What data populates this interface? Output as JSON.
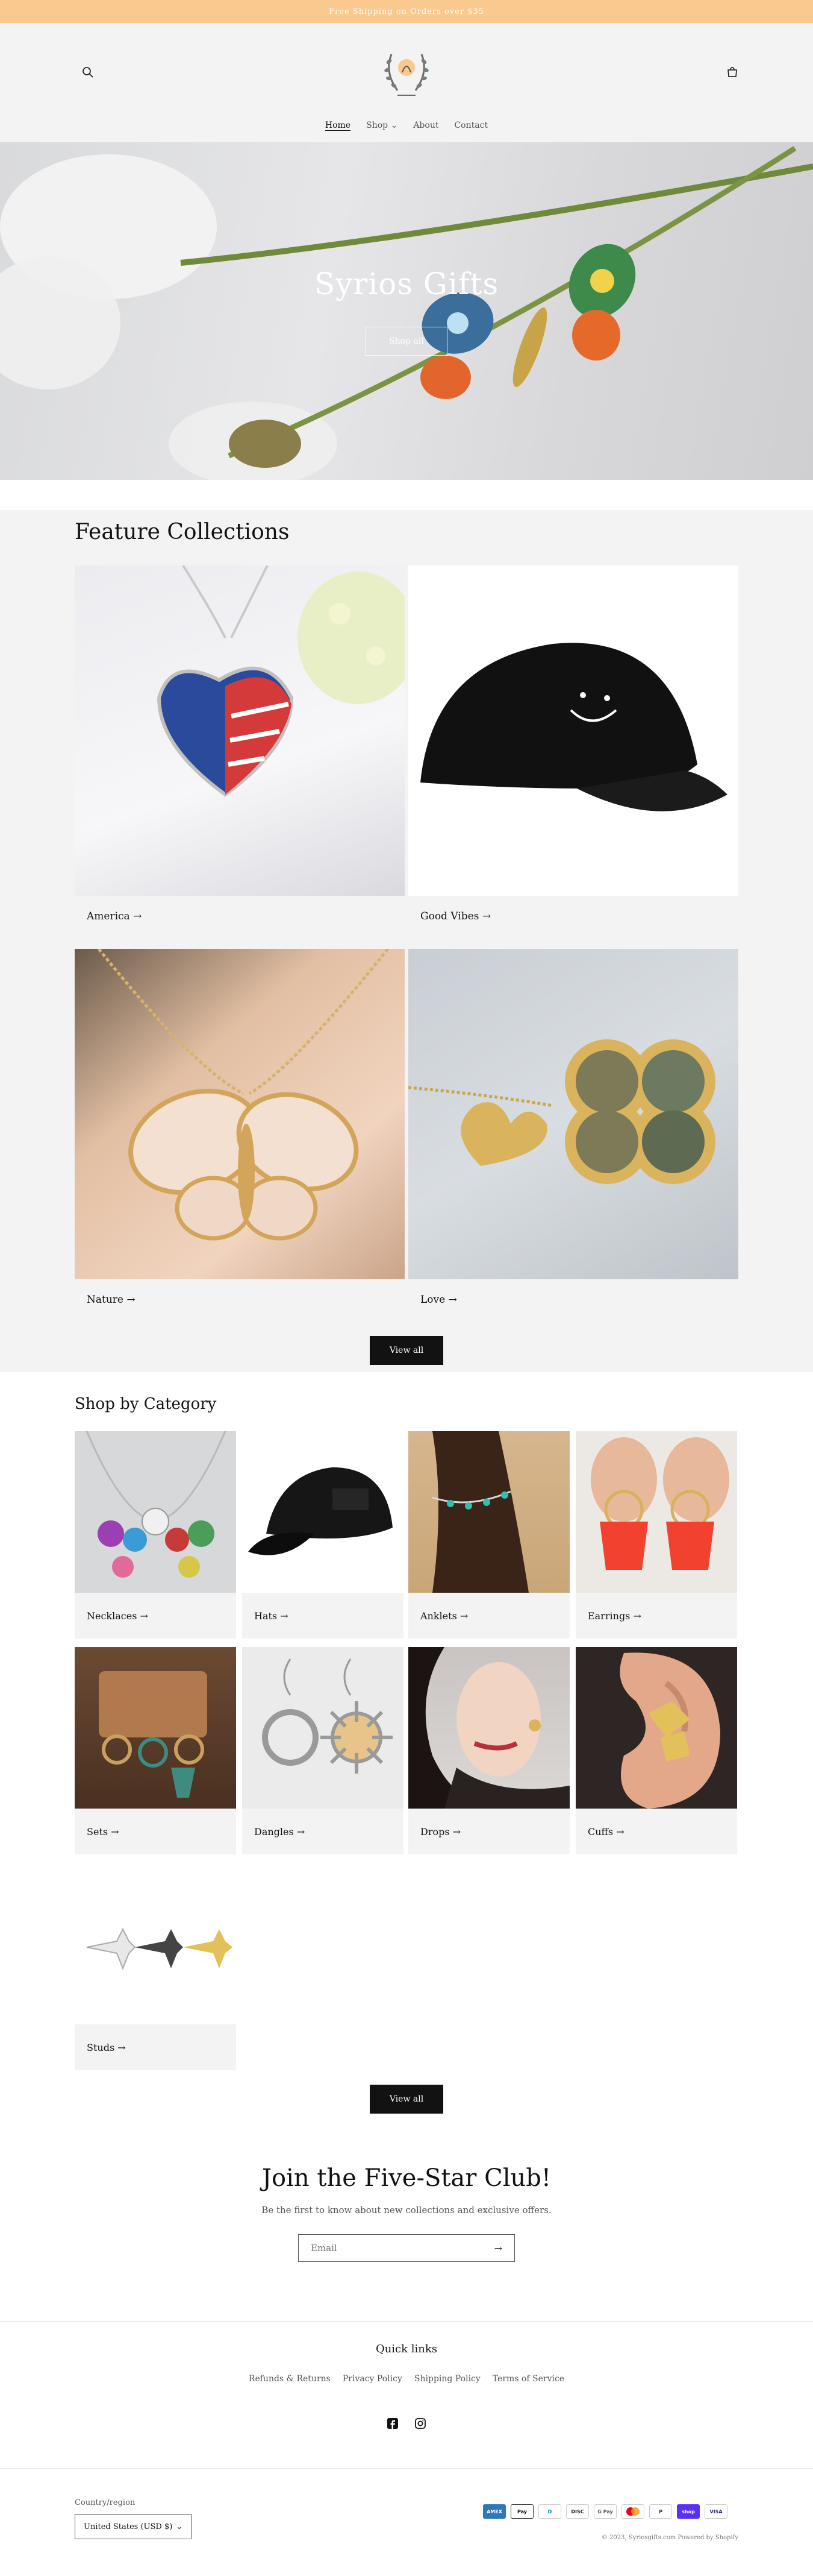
{
  "announcement": "Free Shipping on Orders over $35",
  "header": {
    "search_icon": "search-icon",
    "cart_icon": "cart-icon",
    "nav": [
      "Home",
      "Shop",
      "About",
      "Contact"
    ]
  },
  "hero": {
    "title": "Syrios Gifts",
    "button": "Shop all"
  },
  "feature_collections": {
    "title": "Feature Collections",
    "items": [
      "America",
      "Good Vibes",
      "Nature",
      "Love"
    ],
    "view_all": "View all"
  },
  "shop_by_category": {
    "title": "Shop by Category",
    "items": [
      "Necklaces",
      "Hats",
      "Anklets",
      "Earrings",
      "Sets",
      "Dangles",
      "Drops",
      "Cuffs",
      "Studs"
    ],
    "view_all": "View all"
  },
  "newsletter": {
    "title": "Join the Five-Star Club!",
    "subtitle": "Be the first to know about new collections and exclusive offers.",
    "email_placeholder": "Email"
  },
  "footer": {
    "quick_links_title": "Quick links",
    "links": [
      "Refunds & Returns",
      "Privacy Policy",
      "Shipping Policy",
      "Terms of Service"
    ],
    "social": [
      "facebook-icon",
      "instagram-icon"
    ],
    "country_label": "Country/region",
    "country_value": "United States (USD $)",
    "payment_methods": [
      "Amex",
      "Apple Pay",
      "Diners Club",
      "Discover",
      "Google Pay",
      "Mastercard",
      "PayPal",
      "Shop Pay",
      "Visa"
    ],
    "copyright": "© 2023, Syriosgifts.com Powered by Shopify"
  },
  "colors": {
    "announcement_bg": "#f9c98f",
    "button_dark": "#121212",
    "section_bg": "#f3f3f3"
  }
}
